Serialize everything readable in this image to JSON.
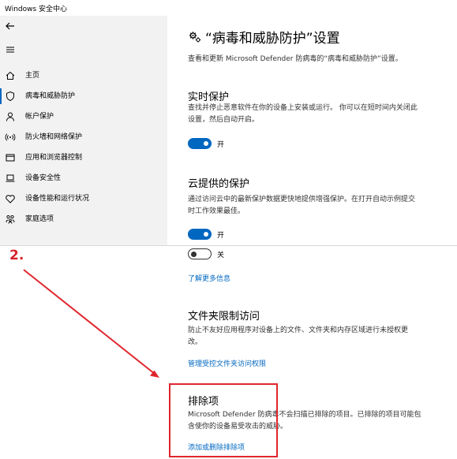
{
  "window": {
    "title": "Windows 安全中心"
  },
  "sidebar": {
    "items": [
      {
        "label": "主页",
        "icon": "home-icon"
      },
      {
        "label": "病毒和威胁防护",
        "icon": "shield-icon",
        "active": true
      },
      {
        "label": "帐户保护",
        "icon": "person-icon"
      },
      {
        "label": "防火墙和网络保护",
        "icon": "wifi-icon"
      },
      {
        "label": "应用和浏览器控制",
        "icon": "app-window-icon"
      },
      {
        "label": "设备安全性",
        "icon": "laptop-icon"
      },
      {
        "label": "设备性能和运行状况",
        "icon": "heart-icon"
      },
      {
        "label": "家庭选项",
        "icon": "family-icon"
      }
    ]
  },
  "page": {
    "title": "“病毒和威胁防护”设置",
    "subtitle": "查看和更新 Microsoft Defender 防病毒的“病毒和威胁防护”设置。"
  },
  "realtime": {
    "title": "实时保护",
    "desc1": "查找并停止恶意软件在你的设备上安装或运行。 你可以在短时间内关闭此",
    "desc2": "设置，然后自动开启。",
    "toggle_label": "开"
  },
  "cloud": {
    "title": "云提供的保护",
    "desc1": "通过访问云中的最新保护数据更快地提供增强保护。在打开自动示例提交",
    "desc2": "时工作效果最佳。",
    "toggle_label": "开"
  },
  "sample": {
    "toggle_label": "关",
    "learn_more": "了解更多信息"
  },
  "folder": {
    "title": "文件夹限制访问",
    "desc1": "防止不友好应用程序对设备上的文件、文件夹和内存区域进行未授权更",
    "desc2": "改。",
    "link": "管理受控文件夹访问权限"
  },
  "exclusions": {
    "title": "排除项",
    "desc1": "Microsoft Defender 防病毒不会扫描已排除的项目。已排除的项目可能包",
    "desc2": "含使你的设备易受攻击的威胁。",
    "link": "添加或删除排除项"
  },
  "annotation": {
    "step": "2.",
    "color": "#e0262d"
  },
  "colors": {
    "accent": "#0067c0",
    "sidebar_bg": "#f2f2f2"
  }
}
